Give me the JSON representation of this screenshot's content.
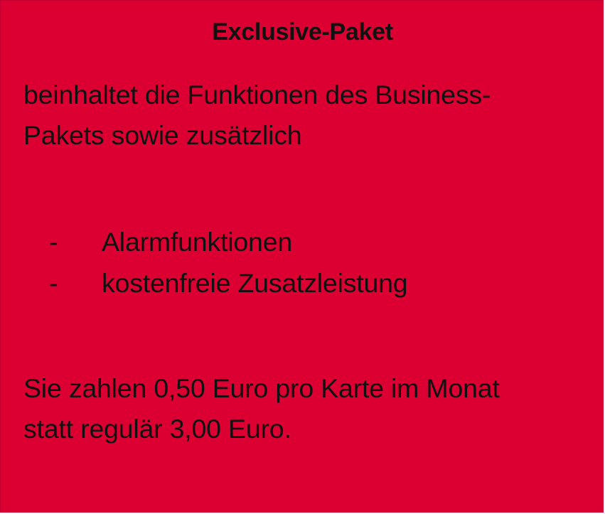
{
  "card": {
    "title": "Exclusive-Paket",
    "intro_lines": [
      "beinhaltet die Funktionen des Business-",
      "Pakets sowie zusätzlich"
    ],
    "bullet_marker": "-",
    "features": [
      "Alarmfunktionen",
      "kostenfreie Zusatzleistung"
    ],
    "price_lines": [
      "Sie zahlen 0,50 Euro pro Karte im Monat",
      "statt regulär 3,00 Euro."
    ],
    "background_color": "#dc0032",
    "text_color": "#111111"
  }
}
